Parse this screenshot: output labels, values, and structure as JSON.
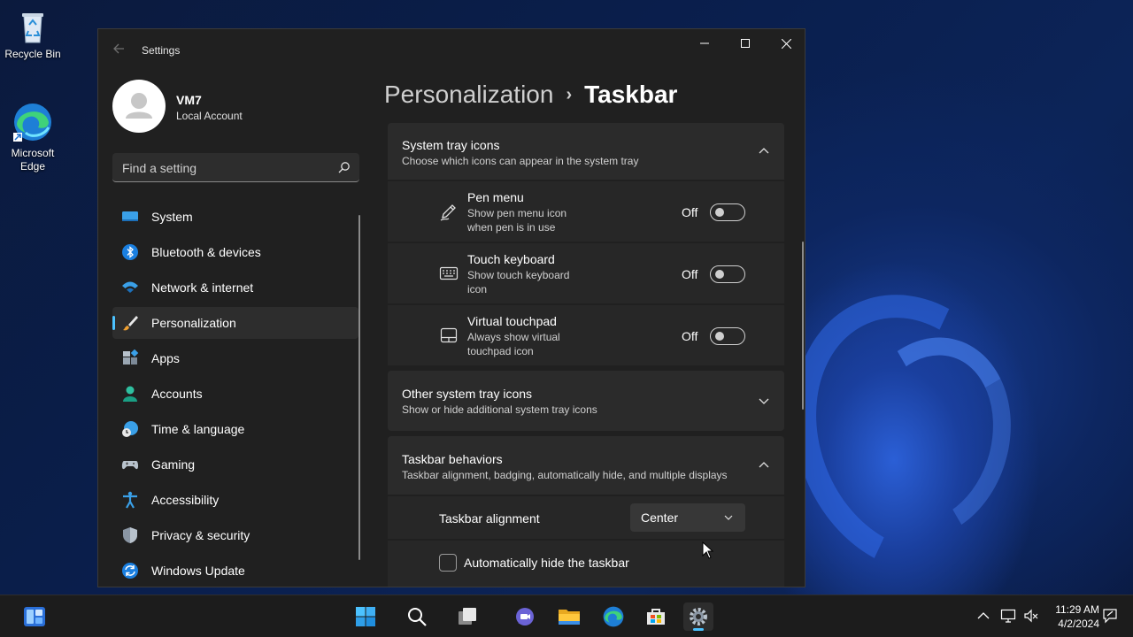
{
  "desktop": {
    "icons": [
      {
        "label": "Recycle Bin",
        "icon": "recycle-bin-icon"
      },
      {
        "label": "Microsoft Edge",
        "icon": "edge-icon"
      }
    ]
  },
  "window": {
    "title": "Settings",
    "controls": [
      "minimize",
      "maximize",
      "close"
    ]
  },
  "profile": {
    "name": "VM7",
    "account_type": "Local Account"
  },
  "search": {
    "placeholder": "Find a setting"
  },
  "sidebar": {
    "items": [
      {
        "label": "System",
        "icon": "system-display-icon"
      },
      {
        "label": "Bluetooth & devices",
        "icon": "bluetooth-icon"
      },
      {
        "label": "Network & internet",
        "icon": "wifi-icon"
      },
      {
        "label": "Personalization",
        "icon": "paintbrush-icon",
        "active": true
      },
      {
        "label": "Apps",
        "icon": "apps-icon"
      },
      {
        "label": "Accounts",
        "icon": "accounts-icon"
      },
      {
        "label": "Time & language",
        "icon": "time-language-icon"
      },
      {
        "label": "Gaming",
        "icon": "gamepad-icon"
      },
      {
        "label": "Accessibility",
        "icon": "accessibility-icon"
      },
      {
        "label": "Privacy & security",
        "icon": "shield-icon"
      },
      {
        "label": "Windows Update",
        "icon": "windows-update-icon"
      }
    ]
  },
  "breadcrumb": {
    "parent": "Personalization",
    "separator": "›",
    "current": "Taskbar"
  },
  "sections": {
    "system_tray": {
      "title": "System tray icons",
      "subtitle": "Choose which icons can appear in the system tray",
      "expanded": true,
      "rows": [
        {
          "title": "Pen menu",
          "subtitle": "Show pen menu icon when pen is in use",
          "state": "Off",
          "icon": "pen-icon"
        },
        {
          "title": "Touch keyboard",
          "subtitle": "Show touch keyboard icon",
          "state": "Off",
          "icon": "keyboard-icon"
        },
        {
          "title": "Virtual touchpad",
          "subtitle": "Always show virtual touchpad icon",
          "state": "Off",
          "icon": "touchpad-icon"
        }
      ]
    },
    "other_tray": {
      "title": "Other system tray icons",
      "subtitle": "Show or hide additional system tray icons",
      "expanded": false
    },
    "behaviors": {
      "title": "Taskbar behaviors",
      "subtitle": "Taskbar alignment, badging, automatically hide, and multiple displays",
      "expanded": true,
      "alignment_label": "Taskbar alignment",
      "alignment_value": "Center",
      "autohide_label": "Automatically hide the taskbar",
      "autohide_checked": false
    }
  },
  "taskbar": {
    "apps": [
      "widgets-icon",
      "start-icon",
      "search-icon",
      "task-view-icon",
      "teams-chat-icon",
      "file-explorer-icon",
      "edge-icon",
      "store-icon",
      "settings-icon"
    ],
    "active_app": "settings-icon",
    "tray": [
      "show-hidden-icons-chevron",
      "network-icon",
      "volume-muted-icon",
      "notification-icon"
    ],
    "time": "11:29 AM",
    "date": "4/2/2024"
  },
  "colors": {
    "accent": "#4cc2ff",
    "window_bg": "#202020",
    "card_bg": "#2b2b2b"
  }
}
